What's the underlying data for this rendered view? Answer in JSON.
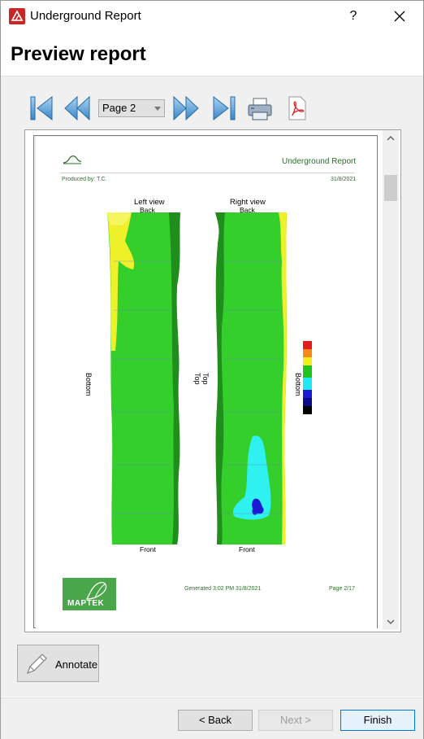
{
  "window": {
    "title": "Underground Report",
    "help_label": "?"
  },
  "header": {
    "title": "Preview report"
  },
  "toolbar": {
    "page_select_value": "Page 2",
    "buttons": [
      "first-page",
      "previous-page",
      "next-page",
      "last-page",
      "print",
      "export-pdf"
    ]
  },
  "report": {
    "header_title": "Underground Report",
    "produced_by": "Produced by: T.C.",
    "date": "31/8/2021",
    "left_view_title": "Left view",
    "right_view_title": "Right view",
    "left_top_label": "Back",
    "right_top_label": "Back",
    "left_bottom_label": "Front",
    "right_bottom_label": "Front",
    "left_side_label": "Bottom",
    "right_side_label": "Bottom",
    "left_inner_label": "Top",
    "right_inner_label": "Top",
    "generated": "Generated 3:02 PM 31/8/2021",
    "page_number": "Page 2/17",
    "logo_text": "MAPTEK",
    "legend_colors": [
      "#e51b1b",
      "#f48a1c",
      "#f2ed1f",
      "#21c321",
      "#1fe8f1",
      "#1b1bd6",
      "#0a0a8a",
      "#000000"
    ]
  },
  "annotate": {
    "label": "Annotate"
  },
  "footer": {
    "back_label": "< Back",
    "next_label": "Next >",
    "finish_label": "Finish"
  }
}
